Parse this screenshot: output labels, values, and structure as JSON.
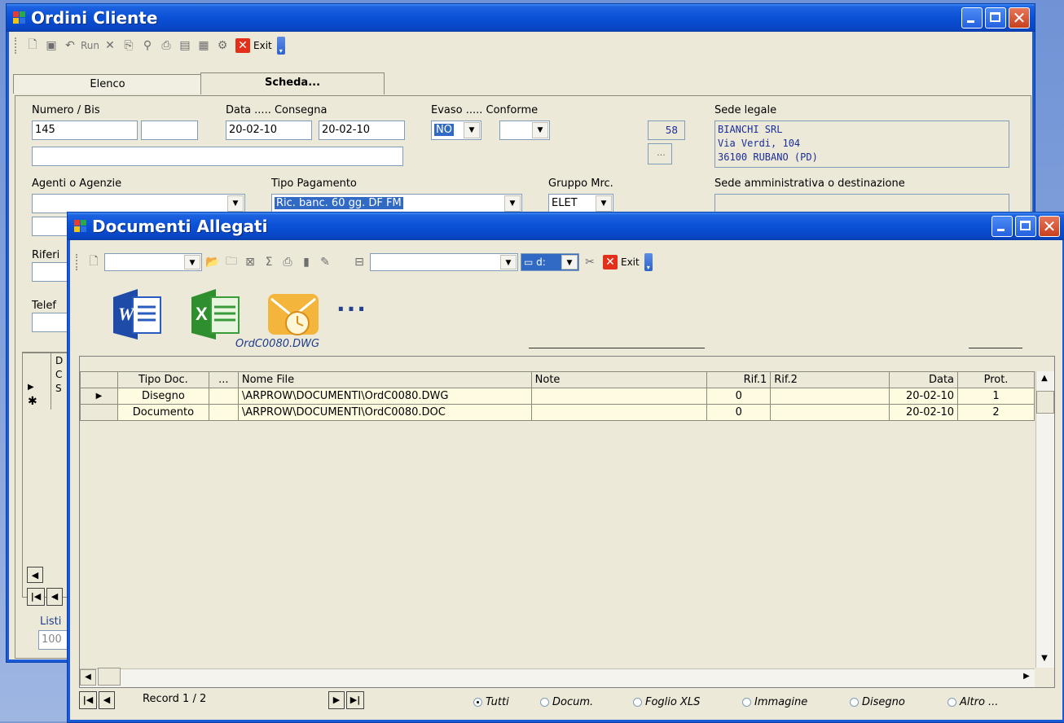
{
  "main_window": {
    "title": "Ordini Cliente",
    "toolbar": {
      "run_label": "Run",
      "exit_label": "Exit"
    },
    "tabs": [
      {
        "label": "Elenco"
      },
      {
        "label": "Scheda..."
      }
    ],
    "form": {
      "numero_label": "Numero / Bis",
      "numero_value": "145",
      "bis_value": "",
      "data_label": "Data ..... Consegna",
      "data_value": "20-02-10",
      "consegna_value": "20-02-10",
      "evaso_label": "Evaso ..... Conforme",
      "evaso_value": "NO",
      "conforme_value": "",
      "code_value": "58",
      "ellipsis_label": "...",
      "sede_label": "Sede legale",
      "sede_value": "BIANCHI SRL\nVia Verdi, 104\n36100 RUBANO (PD)",
      "agenti_label": "Agenti o Agenzie",
      "agenti_value": "",
      "pagamento_label": "Tipo Pagamento",
      "pagamento_value": "Ric. banc. 60 gg. DF FM",
      "gruppo_label": "Gruppo Mrc.",
      "gruppo_value": "ELET",
      "sede_amm_label": "Sede amministrativa o destinazione",
      "riferimento_label": "Riferi",
      "telefono_label": "Telef",
      "listino_label": "Listi",
      "listino_value": "100",
      "side_grid_rows": [
        "D",
        "C",
        "S"
      ]
    }
  },
  "docs_window": {
    "title": "Documenti Allegati",
    "toolbar": {
      "drive_value": "d:",
      "exit_label": "Exit"
    },
    "file_caption": "OrdC0080.DWG",
    "more_dots": "...",
    "columns": [
      "Tipo Doc.",
      "...",
      "Nome File",
      "Note",
      "Rif.1",
      "Rif.2",
      "Data",
      "Prot."
    ],
    "rows": [
      {
        "tipo": "Disegno",
        "extra": "",
        "nome": "\\ARPROW\\DOCUMENTI\\OrdC0080.DWG",
        "note": "",
        "rif1": "0",
        "rif2": "",
        "data": "20-02-10",
        "prot": "1"
      },
      {
        "tipo": "Documento",
        "extra": "",
        "nome": "\\ARPROW\\DOCUMENTI\\OrdC0080.DOC",
        "note": "",
        "rif1": "0",
        "rif2": "",
        "data": "20-02-10",
        "prot": "2"
      }
    ],
    "record_label": "Record 1 / 2",
    "filters": [
      {
        "label": "Tutti",
        "selected": true
      },
      {
        "label": "Docum.",
        "selected": false
      },
      {
        "label": "Foglio XLS",
        "selected": false
      },
      {
        "label": "Immagine",
        "selected": false
      },
      {
        "label": "Disegno",
        "selected": false
      },
      {
        "label": "Altro ...",
        "selected": false
      }
    ]
  }
}
